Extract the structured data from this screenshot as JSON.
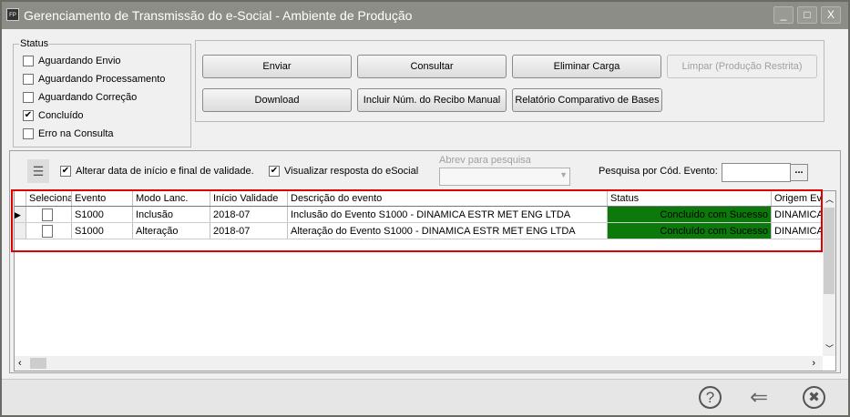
{
  "window": {
    "title": "Gerenciamento de Transmissão do e-Social - Ambiente de Produção",
    "app_icon": "FP",
    "controls": [
      "_",
      "□",
      "X"
    ]
  },
  "status_group": {
    "label": "Status",
    "items": [
      {
        "label": "Aguardando Envio",
        "checked": false
      },
      {
        "label": "Aguardando Processamento",
        "checked": false
      },
      {
        "label": "Aguardando Correção",
        "checked": false
      },
      {
        "label": "Concluído",
        "checked": true
      },
      {
        "label": "Erro na Consulta",
        "checked": false
      }
    ]
  },
  "buttons": {
    "enviar": "Enviar",
    "consultar": "Consultar",
    "eliminar": "Eliminar Carga",
    "limpar": "Limpar (Produção Restrita)",
    "download": "Download",
    "incluir": "Incluir Núm. do Recibo Manual",
    "relatorio": "Relatório Comparativo de Bases"
  },
  "toolbar": {
    "alterar_label": "Alterar data de início e final de validade.",
    "alterar_checked": true,
    "visualizar_label": "Visualizar resposta do eSocial",
    "visualizar_checked": true,
    "abrev_label": "Abrev para pesquisa",
    "abrev_value": "",
    "pesquisa_label": "Pesquisa por Cód. Evento:",
    "pesquisa_value": "",
    "ellipsis": "..."
  },
  "grid": {
    "columns": [
      "Seleciona",
      "Evento",
      "Modo Lanc.",
      "Início Validade",
      "Descrição do evento",
      "Status",
      "Origem Ev"
    ],
    "rows": [
      {
        "selected": false,
        "evento": "S1000",
        "modo": "Inclusão",
        "inicio": "2018-07",
        "descricao": "Inclusão do Evento S1000 - DINAMICA ESTR MET ENG LTDA",
        "status": "Concluído com Sucesso",
        "origem": "DINAMICA"
      },
      {
        "selected": false,
        "evento": "S1000",
        "modo": "Alteração",
        "inicio": "2018-07",
        "descricao": "Alteração do Evento S1000 - DINAMICA ESTR MET ENG LTDA",
        "status": "Concluído com Sucesso",
        "origem": "DINAMICA"
      }
    ],
    "status_color": "#0b7a0b",
    "highlight_color": "#e00000"
  },
  "footer": {
    "help": "?",
    "back": "⇐",
    "close": "✖"
  }
}
